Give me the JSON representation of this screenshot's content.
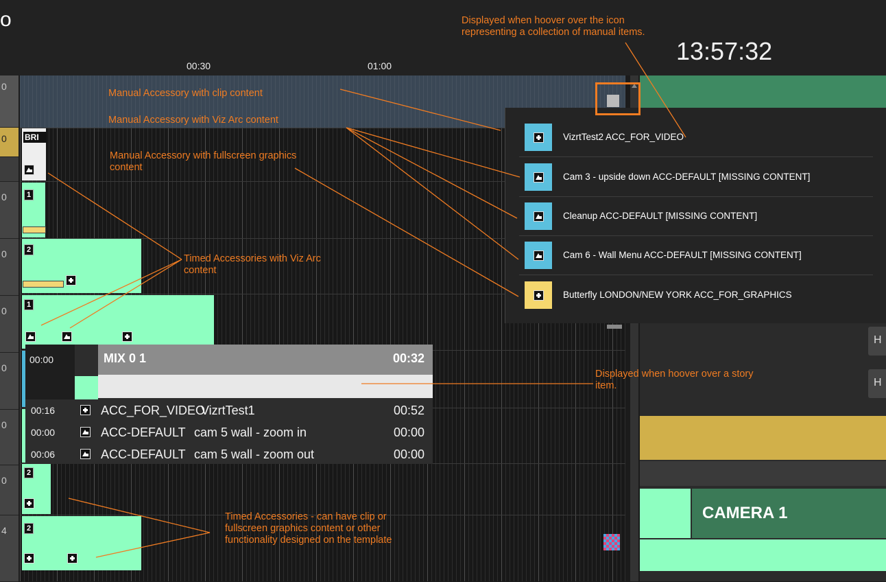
{
  "app": {
    "title_fragment": "o",
    "clock": "13:57:32"
  },
  "ruler": {
    "ticks": [
      "00:30",
      "01:00"
    ]
  },
  "left_column": {
    "fragments": [
      "0",
      "0",
      "0",
      "0",
      "0",
      "0",
      "0",
      "0",
      "4"
    ]
  },
  "timeline": {
    "bri_label": "BRI",
    "numbers": [
      "1",
      "2",
      "1",
      "2",
      "2"
    ]
  },
  "manual_popup": {
    "items": [
      {
        "label": "VizrtTest2 ACC_FOR_VIDEO",
        "icon": "plus-icon",
        "color": "#5bc0de"
      },
      {
        "label": "Cam 3 - upside down ACC-DEFAULT [MISSING CONTENT]",
        "icon": "image-icon",
        "color": "#5bc0de"
      },
      {
        "label": "Cleanup ACC-DEFAULT [MISSING CONTENT]",
        "icon": "image-icon",
        "color": "#5bc0de"
      },
      {
        "label": "Cam 6 - Wall Menu ACC-DEFAULT [MISSING CONTENT]",
        "icon": "image-icon",
        "color": "#5bc0de"
      },
      {
        "label": "Butterfly LONDON/NEW YORK ACC_FOR_GRAPHICS",
        "icon": "plus-icon",
        "color": "#f5d76e"
      }
    ]
  },
  "story_info": {
    "start": "00:00",
    "title": "MIX 0 1",
    "duration": "00:32",
    "rows": [
      {
        "time": "00:16",
        "icon": "plus-icon",
        "kind": "ACC_FOR_VIDEO",
        "name": "VizrtTest1",
        "duration": "00:52"
      },
      {
        "time": "00:00",
        "icon": "image-icon",
        "kind": "ACC-DEFAULT",
        "name": "cam 5 wall - zoom in",
        "duration": "00:00"
      },
      {
        "time": "00:06",
        "icon": "image-icon",
        "kind": "ACC-DEFAULT",
        "name": "cam 5 wall - zoom out",
        "duration": "00:00"
      }
    ]
  },
  "right_panel": {
    "camera_label": "CAMERA 1",
    "button_letters": [
      "H",
      "H"
    ]
  },
  "annotations": {
    "popup_note": "Displayed when hoover over the icon representing a collection of manual items.",
    "manual_clip": "Manual Accessory with clip content",
    "manual_viz": "Manual Accessory with Viz Arc content",
    "manual_fullscreen": "Manual Accessory with fullscreen graphics content",
    "timed_viz": "Timed Accessories with Viz Arc content",
    "story_note": "Displayed when hoover over a story item.",
    "timed_general": "Timed Accessories - can have clip or fullscreen graphics content or other functionality designed on the template"
  },
  "colors": {
    "accent_orange": "#f07c22",
    "clip_green": "#8effc1",
    "popup_blue": "#5bc0de",
    "popup_yellow": "#f5d76e",
    "right_green": "#3e8a62",
    "right_gold": "#d1b04a",
    "camera_dark_green": "#3b7a57"
  }
}
